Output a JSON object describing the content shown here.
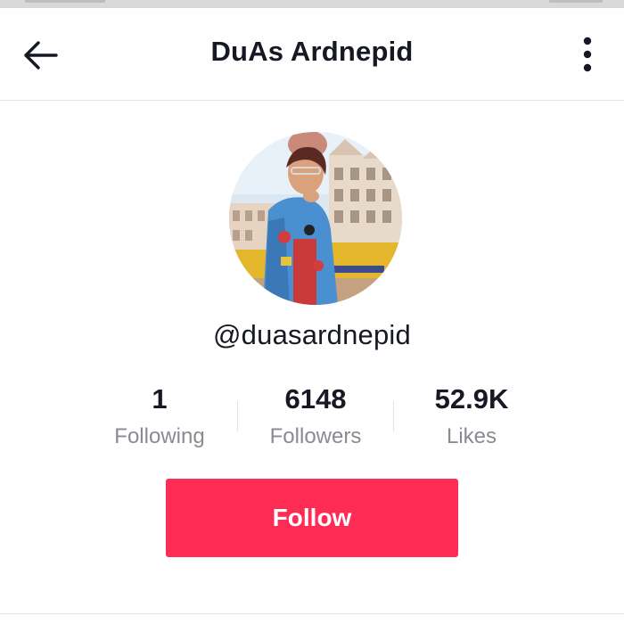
{
  "header": {
    "title": "DuAs Ardnepid",
    "back_icon": "arrow-left-icon",
    "more_icon": "more-vertical-icon"
  },
  "profile": {
    "username": "@duasardnepid",
    "avatar": "profile-photo"
  },
  "stats": [
    {
      "value": "1",
      "label": "Following"
    },
    {
      "value": "6148",
      "label": "Followers"
    },
    {
      "value": "52.9K",
      "label": "Likes"
    }
  ],
  "actions": {
    "follow_label": "Follow"
  },
  "colors": {
    "accent": "#fe2c55",
    "text": "#161823",
    "secondary_text": "#8a8b91",
    "divider": "#e3e3e4"
  }
}
